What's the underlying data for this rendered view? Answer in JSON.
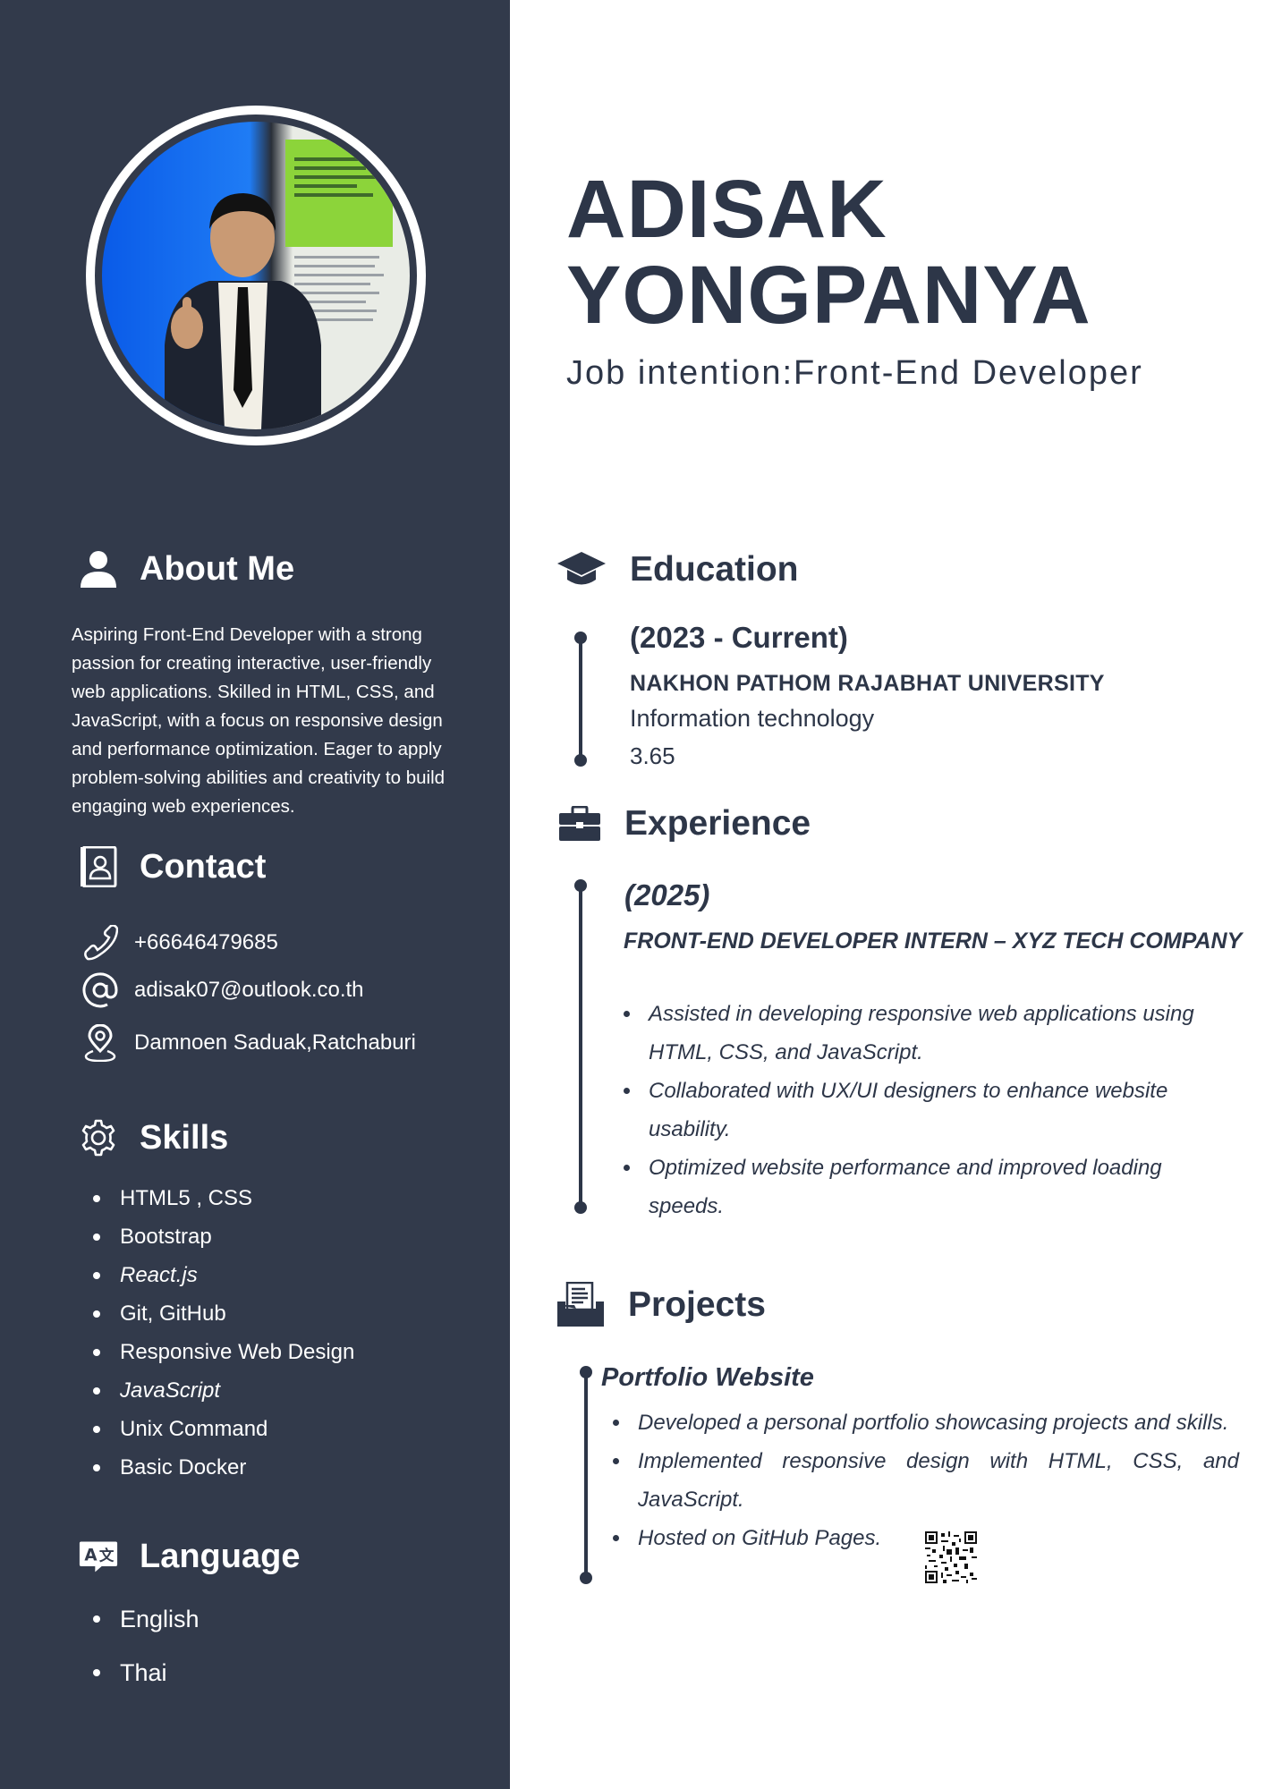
{
  "header": {
    "first_name": "ADISAK",
    "last_name": "YONGPANYA",
    "job_intention": "Job intention:Front-End Developer"
  },
  "about": {
    "title": "About Me",
    "icon": "user-icon",
    "text": "Aspiring Front-End Developer with a strong passion for creating interactive, user-friendly web applications. Skilled in HTML, CSS, and JavaScript, with a focus on responsive design and performance optimization. Eager to apply problem-solving abilities and creativity to build engaging web experiences."
  },
  "contact": {
    "title": "Contact",
    "icon": "contact-book-icon",
    "phone": "+66646479685",
    "email": "adisak07@outlook.co.th",
    "address": "Damnoen Saduak,Ratchaburi"
  },
  "skills": {
    "title": "Skills",
    "icon": "gear-icon",
    "items": [
      "HTML5 , CSS",
      "Bootstrap",
      "React.js",
      "Git, GitHub",
      "Responsive Web Design",
      "JavaScript",
      "Unix Command",
      "Basic Docker"
    ]
  },
  "language": {
    "title": "Language",
    "icon": "translate-icon",
    "items": [
      "English",
      "Thai"
    ]
  },
  "education": {
    "title": "Education",
    "icon": "graduation-cap-icon",
    "period": "(2023 - Current)",
    "school": "NAKHON PATHOM RAJABHAT UNIVERSITY",
    "field": "Information technology",
    "gpa": "3.65"
  },
  "experience": {
    "title": "Experience",
    "icon": "briefcase-icon",
    "year": "(2025)",
    "role": "FRONT-END DEVELOPER INTERN – XYZ TECH COMPANY",
    "bullets": [
      "Assisted in developing responsive web applications using HTML, CSS, and JavaScript.",
      "Collaborated with UX/UI designers to enhance website usability.",
      "Optimized website performance and improved loading speeds."
    ]
  },
  "projects": {
    "title": "Projects",
    "icon": "folder-document-icon",
    "project_title": "Portfolio Website",
    "bullets": [
      "Developed a personal portfolio showcasing projects and skills.",
      "Implemented responsive design with HTML, CSS, and JavaScript.",
      "Hosted on GitHub Pages."
    ]
  },
  "colors": {
    "sidebar_bg": "#323a4b",
    "text_dark": "#2d3648",
    "text_light": "#ffffff"
  }
}
